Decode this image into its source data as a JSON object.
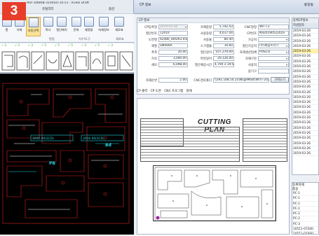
{
  "badge": "3",
  "left_window": {
    "title": "AUF-D4808-3100(0)-10-51 - Kvikk Draft",
    "subtitle_left": "유틸리티",
    "subtitle_right": "옵션",
    "ribbon": [
      {
        "label": "홈"
      },
      {
        "label": "삭제"
      },
      {
        "label": "자동선택"
      },
      {
        "label": "복사"
      },
      {
        "label": "절단배치"
      },
      {
        "label": "전체"
      },
      {
        "label": "재정렬"
      },
      {
        "label": "자재정보"
      },
      {
        "label": "재료표"
      }
    ],
    "ribbon_groups": [
      "편집",
      "치수/도구",
      "재료표"
    ],
    "check_labels": [
      "√ 3",
      "√ 3",
      "√ 3",
      "√ 5",
      "√ 5",
      "√ 5",
      "√ 3",
      "√ 5",
      "√ 3"
    ],
    "cad_header": "도면창",
    "cad_labels": [
      "3000.00(SCD)",
      "3000.00(SCD)",
      "PB",
      "Bd"
    ],
    "cad_colors": {
      "red": "#e02020",
      "white": "#ffffff",
      "cyan": "#22d5e0",
      "bg": "#000000"
    }
  },
  "right_window": {
    "title": "CP 정보",
    "user": "홍길동",
    "cp_info": {
      "header": "CP 정보",
      "fields": [
        {
          "label": "CP등록일",
          "value": "2019-03-18",
          "disabled": true
        },
        {
          "label": "절단번호",
          "value": "12010"
        },
        {
          "label": "도면명",
          "value": "92480_DHDA3.058R"
        },
        {
          "label": "재질",
          "value": "SM490A"
        },
        {
          "label": "폭폭",
          "value": "20.00"
        },
        {
          "label": "가로",
          "value": "3,000.00"
        },
        {
          "label": "세로",
          "value": "6,098.00"
        }
      ],
      "mid_fields": [
        {
          "label": "자재중량",
          "value": "5,742.43"
        },
        {
          "label": "사용중량",
          "value": "4,617.04"
        },
        {
          "label": "사용율",
          "value": "80.40"
        },
        {
          "label": "스크랩율",
          "value": "19.60"
        },
        {
          "label": "절단길이",
          "value": "107,379.00"
        },
        {
          "label": "마킹길이",
          "value": "20,126.00"
        },
        {
          "label": "절단예상시간",
          "value": "4,794  1:19:54"
        }
      ],
      "right_fields": [
        {
          "label": "CNC명칭",
          "value": "WITT-2"
        },
        {
          "label": "CP번호",
          "value": "KH2019052202S"
        },
        {
          "label": "가공처",
          "value": ""
        },
        {
          "label": "절단가공처",
          "value": "(주)세림프라크"
        },
        {
          "label": "자재생산업체",
          "value": "POSCO"
        },
        {
          "label": "자재구분",
          "value": ""
        },
        {
          "label": "사용처",
          "value": ""
        },
        {
          "label": "용기구",
          "value": ""
        }
      ],
      "nest_no_label": "자재순번",
      "nest_no_value": "2.00",
      "cnc_path_label": "CNC경로폴더",
      "cnc_path_value": "\\\\192.168.50.25\\NcgeMast\\WITT-2\\U20",
      "browse_button": "가져오기"
    },
    "tabs": [
      "CP 출력",
      "CP 도면",
      "CNC 프로그램",
      "원재"
    ],
    "document": {
      "title": "CUTTING PLAN",
      "sheet_note": "PP PP"
    },
    "list": {
      "header": "동록CP정보",
      "column": "작성일자",
      "rows": [
        "2019-03-26",
        "2019-03-26",
        "2019-03-26",
        "2019-03-26",
        "2019-03-26",
        "2019-03-26",
        "2019-03-26",
        "2019-03-26",
        "2019-03-26",
        "2019-03-26",
        "2019-03-26",
        "2019-03-26",
        "2019-03-26",
        "2019-03-26",
        "2019-03-26",
        "2019-03-26",
        "2019-03-26",
        "2019-03-26",
        "2019-03-26",
        "2019-03-26",
        "2019-03-26",
        "2019-03-26",
        "2019-03-26",
        "2019-03-26",
        "2019-03-26"
      ],
      "selected_index": 4
    },
    "list2": {
      "header": "등록자재",
      "column": "품옹",
      "rows": [
        "PC-1",
        "PC-1",
        "PC-1",
        "PC-1",
        "PC-2",
        "PC-2",
        "PC-3",
        "10511-07200",
        "10511-07400",
        "10511-07400"
      ]
    }
  }
}
